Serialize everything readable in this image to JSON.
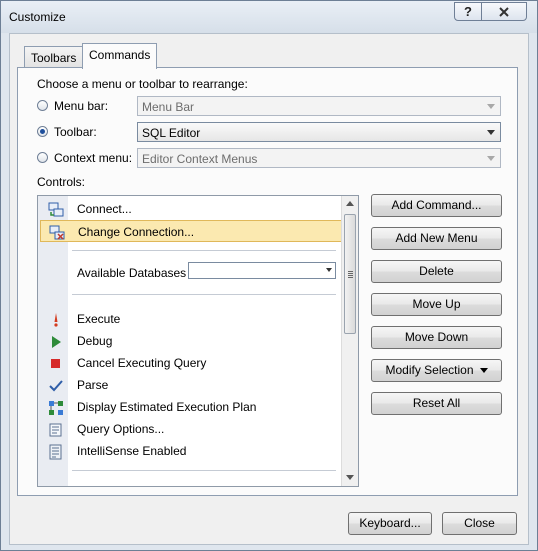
{
  "window": {
    "title": "Customize",
    "help_glyph": "?",
    "close_glyph": "X"
  },
  "tabs": [
    {
      "label": "Toolbars",
      "active": false
    },
    {
      "label": "Commands",
      "active": true
    }
  ],
  "choose_label": "Choose a menu or toolbar to rearrange:",
  "options": {
    "menu_bar": {
      "label": "Menu bar:",
      "value": "Menu Bar",
      "selected": false,
      "enabled": false
    },
    "toolbar": {
      "label": "Toolbar:",
      "value": "SQL Editor",
      "selected": true,
      "enabled": true
    },
    "context_menu": {
      "label": "Context menu:",
      "value": "Editor Context Menus",
      "selected": false,
      "enabled": false
    }
  },
  "controls_label": "Controls:",
  "controls": [
    {
      "label": "Connect...",
      "icon": "connect-icon"
    },
    {
      "label": "Change Connection...",
      "icon": "change-connection-icon",
      "selected": true
    },
    {
      "label": "Available Databases",
      "icon": "none",
      "combo_value": ""
    },
    {
      "label": "Execute",
      "icon": "exclamation-icon"
    },
    {
      "label": "Debug",
      "icon": "play-icon"
    },
    {
      "label": "Cancel Executing Query",
      "icon": "stop-icon"
    },
    {
      "label": "Parse",
      "icon": "checkmark-icon"
    },
    {
      "label": "Display Estimated Execution Plan",
      "icon": "execution-plan-icon"
    },
    {
      "label": "Query Options...",
      "icon": "query-options-icon"
    },
    {
      "label": "IntelliSense Enabled",
      "icon": "intellisense-icon"
    }
  ],
  "buttons": {
    "add_command": "Add Command...",
    "add_new_menu": "Add New Menu",
    "delete": "Delete",
    "move_up": "Move Up",
    "move_down": "Move Down",
    "modify_selection": "Modify Selection",
    "reset_all": "Reset All"
  },
  "footer": {
    "keyboard": "Keyboard...",
    "close": "Close"
  },
  "colors": {
    "selection_bg": "#fbe9b0",
    "selection_border": "#e0b85a",
    "accent": "#1e4f9c"
  }
}
